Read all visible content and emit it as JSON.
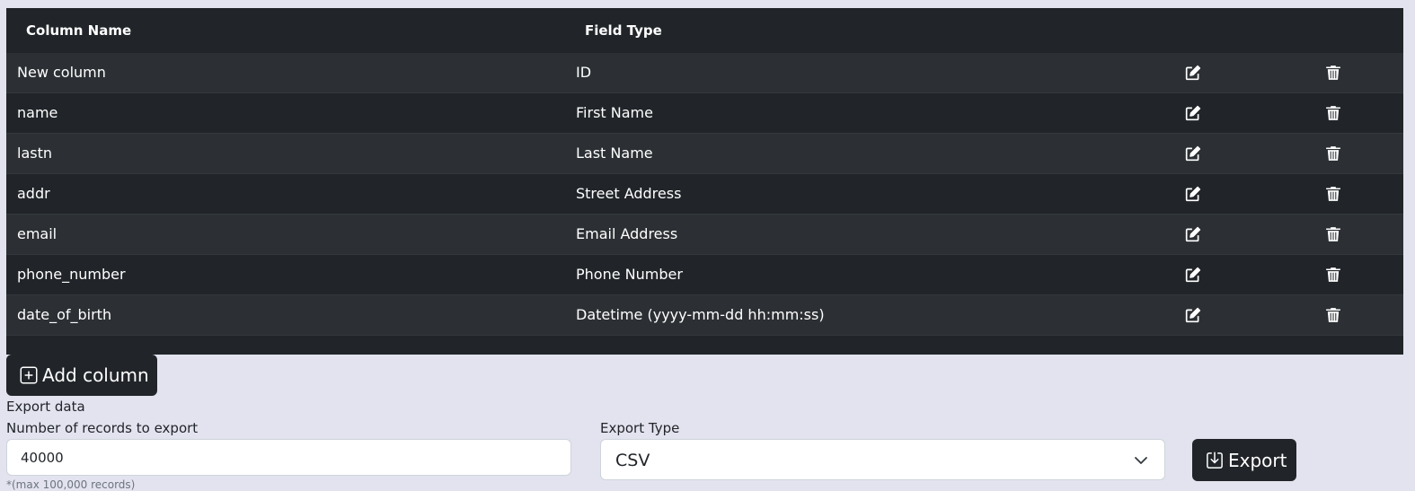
{
  "table": {
    "headers": {
      "column_name": "Column Name",
      "field_type": "Field Type"
    },
    "rows": [
      {
        "name": "New column",
        "type": "ID"
      },
      {
        "name": "name",
        "type": "First Name"
      },
      {
        "name": "lastn",
        "type": "Last Name"
      },
      {
        "name": "addr",
        "type": "Street Address"
      },
      {
        "name": "email",
        "type": "Email Address"
      },
      {
        "name": "phone_number",
        "type": "Phone Number"
      },
      {
        "name": "date_of_birth",
        "type": "Datetime (yyyy-mm-dd hh:mm:ss)"
      }
    ],
    "row_actions": {
      "edit_icon": "edit-icon",
      "delete_icon": "trash-icon"
    }
  },
  "add_column": {
    "label": "Add column",
    "icon": "plus-square-icon"
  },
  "export": {
    "heading": "Export data",
    "records_label": "Number of records to export",
    "records_value": "40000",
    "records_hint": "*(max 100,000 records)",
    "type_label": "Export Type",
    "type_value": "CSV",
    "button_label": "Export",
    "button_icon": "download-icon"
  },
  "colors": {
    "page_bg": "#e3e3ef",
    "table_dark": "#212529",
    "table_striped": "#2c3034",
    "text_light": "#ffffff"
  }
}
